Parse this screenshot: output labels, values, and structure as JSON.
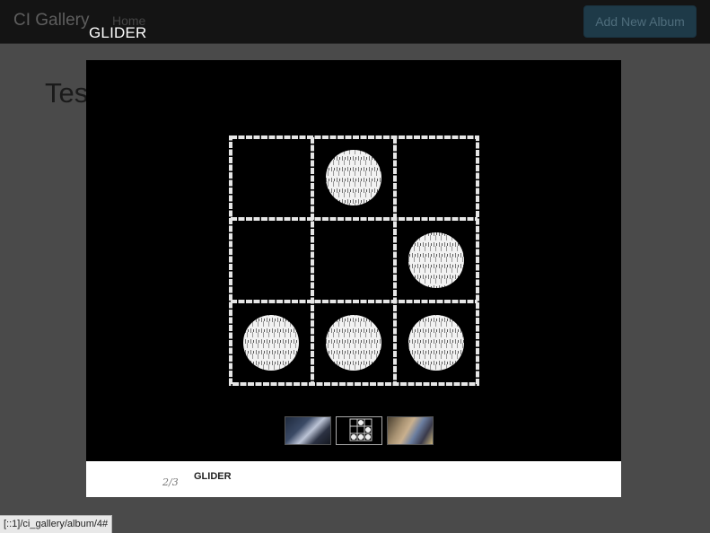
{
  "navbar": {
    "brand": "CI Gallery",
    "home_link": "Home",
    "add_album_button": "Add New Album"
  },
  "page": {
    "heading_partial": "Tes"
  },
  "lightbox": {
    "title": "GLIDER",
    "counter": "2/3",
    "caption": "GLIDER",
    "image_subject": "glider-pattern",
    "thumbnails": [
      {
        "name": "thumbnail-1",
        "active": false
      },
      {
        "name": "thumbnail-2-glider",
        "active": true
      },
      {
        "name": "thumbnail-3",
        "active": false
      }
    ]
  },
  "statusbar": {
    "url": "[::1]/ci_gallery/album/4#"
  }
}
